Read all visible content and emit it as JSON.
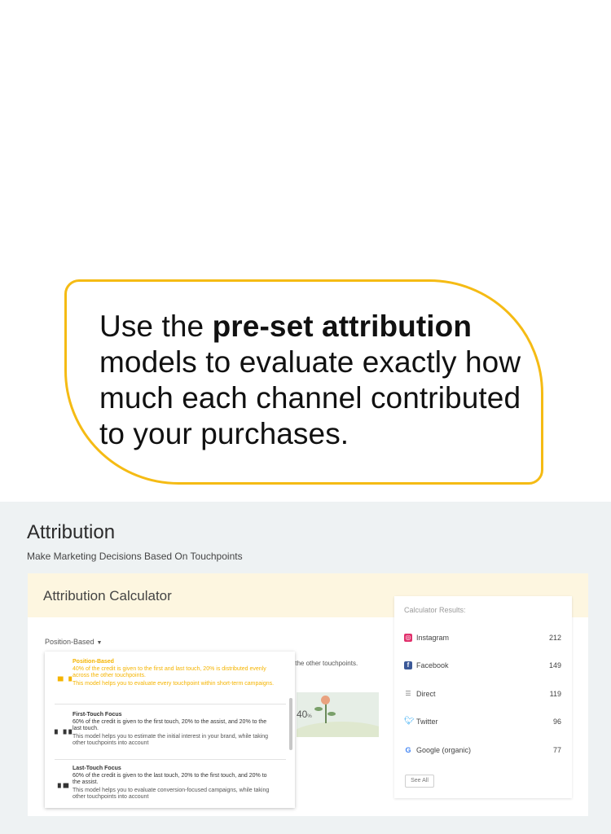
{
  "callout": {
    "text_before": "Use the ",
    "text_bold": "pre-set attribution",
    "text_after": " models to evaluate exactly how much each channel contributed to your purchases."
  },
  "page": {
    "title": "Attribution",
    "subtitle": "Make Marketing Decisions Based On Touchpoints"
  },
  "calculator": {
    "title": "Attribution Calculator",
    "selected_model": "Position-Based",
    "hint_text": "s the other touchpoints.",
    "illustration_percent": "40",
    "illustration_percent_unit": "%"
  },
  "models": [
    {
      "name": "Position-Based",
      "credit": "40% of the credit is given to the first and last touch, 20% is distributed evenly across the other touchpoints.",
      "desc": "This model helps you to evaluate every touchpoint within short-term campaigns.",
      "active": true
    },
    {
      "name": "First-Touch Focus",
      "credit": "60% of the credit is given to the first touch, 20% to the assist, and 20% to the last touch.",
      "desc": "This model helps you to estimate the initial interest in your brand, while taking other touchpoints into account",
      "active": false
    },
    {
      "name": "Last-Touch Focus",
      "credit": "60% of the credit is given to the last touch, 20% to the first touch, and 20% to the assist.",
      "desc": "This model helps you to evaluate conversion-focused campaigns, while taking other touchpoints into account",
      "active": false
    }
  ],
  "results": {
    "title": "Calculator Results:",
    "rows": [
      {
        "label": "Instagram",
        "value": "212",
        "icon": "instagram-icon",
        "color": "#e1306c"
      },
      {
        "label": "Facebook",
        "value": "149",
        "icon": "facebook-icon",
        "color": "#3b5998"
      },
      {
        "label": "Direct",
        "value": "119",
        "icon": "direct-icon",
        "color": "#777777"
      },
      {
        "label": "Twitter",
        "value": "96",
        "icon": "twitter-icon",
        "color": "#1da1f2"
      },
      {
        "label": "Google (organic)",
        "value": "77",
        "icon": "google-icon",
        "color": "#4285f4"
      }
    ],
    "see_all": "See All"
  },
  "colors": {
    "accent": "#f5bb14",
    "header_bg": "#fdf6e0",
    "app_bg": "#eef2f3"
  }
}
